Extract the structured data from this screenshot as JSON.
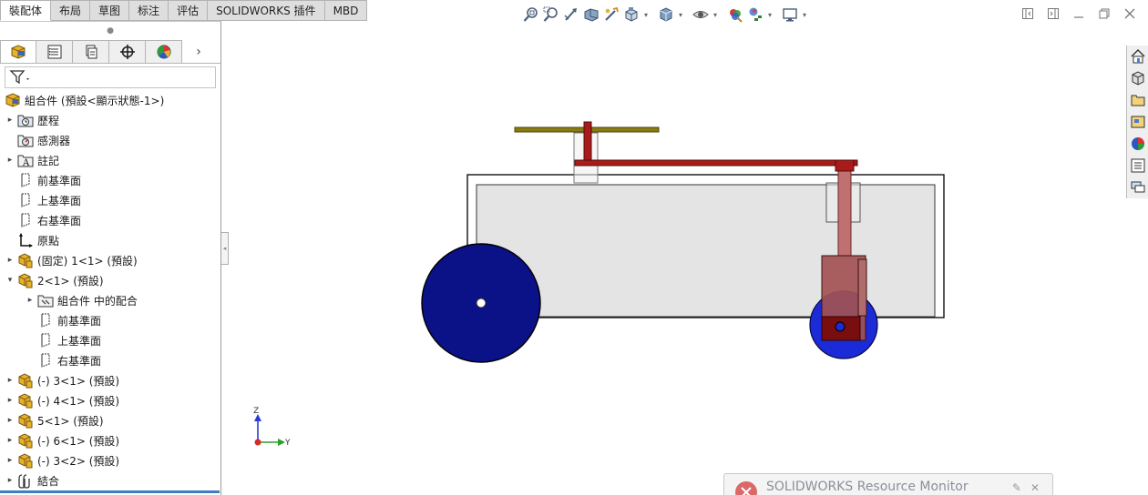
{
  "command_tabs": [
    {
      "label": "裝配体",
      "active": true
    },
    {
      "label": "布局",
      "active": false
    },
    {
      "label": "草图",
      "active": false
    },
    {
      "label": "标注",
      "active": false
    },
    {
      "label": "评估",
      "active": false
    },
    {
      "label": "SOLIDWORKS 插件",
      "active": false
    },
    {
      "label": "MBD",
      "active": false
    }
  ],
  "heads_up_toolbar": [
    "zoom-to-fit-icon",
    "zoom-to-area-icon",
    "previous-view-icon",
    "section-view-icon",
    "dynamic-annotation-icon",
    "view-orientation-icon",
    "display-style-icon",
    "hide-show-icon",
    "edit-appearance-icon",
    "apply-scene-icon",
    "view-settings-icon"
  ],
  "panel_tabs": [
    "featuremanager-icon",
    "propertymanager-icon",
    "configurationmanager-icon",
    "dimxpertmanager-icon",
    "displaymanager-icon"
  ],
  "panel_more": "›",
  "feature_tree": [
    {
      "label": "組合件  (預設<顯示狀態-1>)",
      "icon": "assembly-icon",
      "indent": 0,
      "arrow": ""
    },
    {
      "label": "歷程",
      "icon": "history-icon",
      "indent": 1,
      "arrow": "▸"
    },
    {
      "label": "感測器",
      "icon": "sensor-icon",
      "indent": 1,
      "arrow": ""
    },
    {
      "label": "註記",
      "icon": "annotation-icon",
      "indent": 1,
      "arrow": "▸"
    },
    {
      "label": "前基準面",
      "icon": "plane-icon",
      "indent": 1,
      "arrow": ""
    },
    {
      "label": "上基準面",
      "icon": "plane-icon",
      "indent": 1,
      "arrow": ""
    },
    {
      "label": "右基準面",
      "icon": "plane-icon",
      "indent": 1,
      "arrow": ""
    },
    {
      "label": "原點",
      "icon": "origin-icon",
      "indent": 1,
      "arrow": ""
    },
    {
      "label": "(固定) 1<1> (預設)",
      "icon": "part-icon",
      "indent": 1,
      "arrow": "▸"
    },
    {
      "label": "2<1> (預設)",
      "icon": "part-icon",
      "indent": 1,
      "arrow": "▾"
    },
    {
      "label": "組合件 中的配合",
      "icon": "mates-icon",
      "indent": 2,
      "arrow": "▸"
    },
    {
      "label": "前基準面",
      "icon": "plane-icon",
      "indent": 2,
      "arrow": ""
    },
    {
      "label": "上基準面",
      "icon": "plane-icon",
      "indent": 2,
      "arrow": ""
    },
    {
      "label": "右基準面",
      "icon": "plane-icon",
      "indent": 2,
      "arrow": ""
    },
    {
      "label": "(-) 3<1> (預設)",
      "icon": "part-icon",
      "indent": 1,
      "arrow": "▸"
    },
    {
      "label": "(-) 4<1> (預設)",
      "icon": "part-icon",
      "indent": 1,
      "arrow": "▸"
    },
    {
      "label": "5<1> (預設)",
      "icon": "part-icon",
      "indent": 1,
      "arrow": "▸"
    },
    {
      "label": "(-) 6<1> (預設)",
      "icon": "part-icon",
      "indent": 1,
      "arrow": "▸"
    },
    {
      "label": "(-) 3<2> (預設)",
      "icon": "part-icon",
      "indent": 1,
      "arrow": "▸"
    },
    {
      "label": "結合",
      "icon": "mates-folder-icon",
      "indent": 1,
      "arrow": "▸"
    }
  ],
  "triad": {
    "z_label": "Z",
    "y_label": "Y"
  },
  "task_pane": [
    "home-icon",
    "design-library-icon",
    "file-explorer-icon",
    "view-palette-icon",
    "appearances-icon",
    "custom-properties-icon",
    "forum-icon"
  ],
  "resource_monitor": {
    "title": "SOLIDWORKS Resource Monitor"
  },
  "colors": {
    "wheel_dark": "#0b1186",
    "wheel_light": "#1b2bd8",
    "shaft_red": "#a81b1b",
    "plate_olive": "#8a7a12",
    "body_fill": "#e4e4e4"
  }
}
